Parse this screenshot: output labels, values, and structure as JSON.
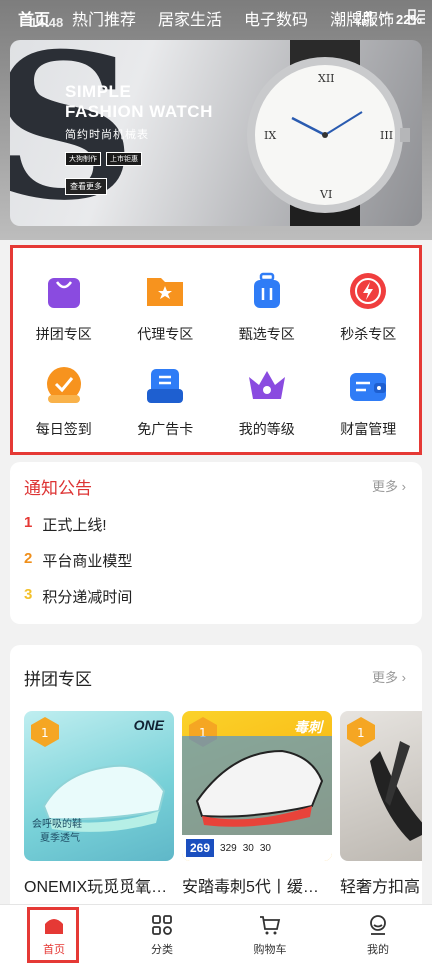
{
  "status_bar": {
    "time": "14:48",
    "battery": "22%",
    "net_speed_top": "7.40",
    "net_speed_bottom": "KB/s"
  },
  "top_nav": {
    "tabs": [
      "首页",
      "热门推荐",
      "居家生活",
      "电子数码",
      "潮牌服饰"
    ]
  },
  "banner": {
    "slogan_line1": "SIMPLE",
    "slogan_line2": "FASHION WATCH",
    "subtitle": "简约时尚机械表",
    "chip1": "大狗制作",
    "chip2": "上市钜惠",
    "cta": "查看更多",
    "dots_count": 4,
    "active_dot": 3
  },
  "features": [
    {
      "label": "拼团专区",
      "icon": "shopping-bag-icon",
      "color": "#8a4be0"
    },
    {
      "label": "代理专区",
      "icon": "folder-star-icon",
      "color": "#f7931e"
    },
    {
      "label": "甄选专区",
      "icon": "luggage-icon",
      "color": "#2f7cf6"
    },
    {
      "label": "秒杀专区",
      "icon": "flash-clock-icon",
      "color": "#f03e3e"
    },
    {
      "label": "每日签到",
      "icon": "check-badge-icon",
      "color": "#f7931e"
    },
    {
      "label": "免广告卡",
      "icon": "document-card-icon",
      "color": "#2f7cf6"
    },
    {
      "label": "我的等级",
      "icon": "crown-icon",
      "color": "#8a4be0"
    },
    {
      "label": "财富管理",
      "icon": "wallet-icon",
      "color": "#2f7cf6"
    }
  ],
  "notice": {
    "title": "通知公告",
    "more": "更多 ›",
    "items": [
      {
        "num": "1",
        "text": "正式上线!"
      },
      {
        "num": "2",
        "text": "平台商业模型"
      },
      {
        "num": "3",
        "text": "积分递减时间"
      }
    ]
  },
  "group_buy": {
    "title": "拼团专区",
    "more": "更多 ›",
    "products": [
      {
        "title": "ONEMIX玩觅觅氧…",
        "img_text1": "会呼吸的鞋",
        "img_text2": "夏季透气",
        "brand": "ONE"
      },
      {
        "title": "安踏毒刺5代丨缓…",
        "brand": "毒刺",
        "price": "269",
        "c1": "329",
        "c2": "30",
        "c3": "30"
      },
      {
        "title": "轻奢方扣高"
      }
    ]
  },
  "bottom_nav": {
    "items": [
      {
        "label": "首页",
        "icon": "home-icon"
      },
      {
        "label": "分类",
        "icon": "category-icon"
      },
      {
        "label": "购物车",
        "icon": "cart-icon"
      },
      {
        "label": "我的",
        "icon": "profile-icon"
      }
    ]
  },
  "colors": {
    "accent": "#e53935",
    "notice_title": "#dd3333"
  }
}
